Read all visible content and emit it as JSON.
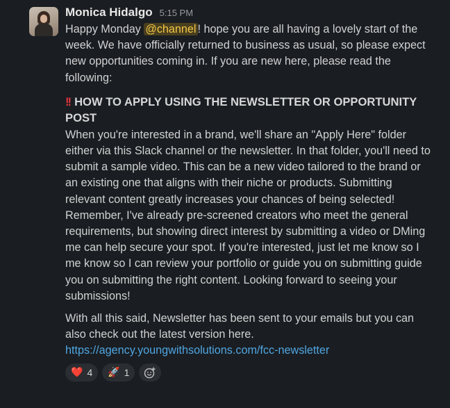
{
  "message": {
    "sender": "Monica Hidalgo",
    "time": "5:15 PM",
    "intro_prefix": "Happy Monday ",
    "mention": "@channel",
    "intro_suffix": "! hope you are all having a lovely start of the week. We have officially returned to business as usual, so please expect new opportunities coming in. If you are new here, please read the following:",
    "heading_emoji": "!!",
    "heading": "HOW TO APPLY USING THE NEWSLETTER OR OPPORTUNITY POST",
    "body": "When you're interested in a brand, we'll share an \"Apply Here\" folder either via this Slack channel or the newsletter. In that folder, you'll need to submit a sample video. This can be a new video tailored to the brand or an existing one that aligns with their niche or products. Submitting relevant content greatly increases your chances of being selected! Remember, I've already pre-screened creators who meet the general requirements, but showing direct interest by submitting a video or DMing me can help secure your spot. If you're interested, just let me know so I me know so I can review your portfolio or guide you on submitting guide you on submitting the right content. Looking forward to seeing your submissions!",
    "closing": "With all this said, Newsletter has been sent to your emails but you can also check out the latest version here.",
    "link": "https://agency.youngwithsolutions.com/fcc-newsletter"
  },
  "reactions": [
    {
      "emoji": "❤️",
      "count": "4",
      "icon": "heart-icon"
    },
    {
      "emoji": "🚀",
      "count": "1",
      "icon": "rocket-icon"
    }
  ],
  "add_reaction_icon": "add-reaction-icon",
  "colors": {
    "background": "#1a1d21",
    "mention_text": "#f2c744",
    "mention_bg": "#4a3f1f",
    "link": "#4fa6e3",
    "heading_bang": "#e0353d"
  }
}
